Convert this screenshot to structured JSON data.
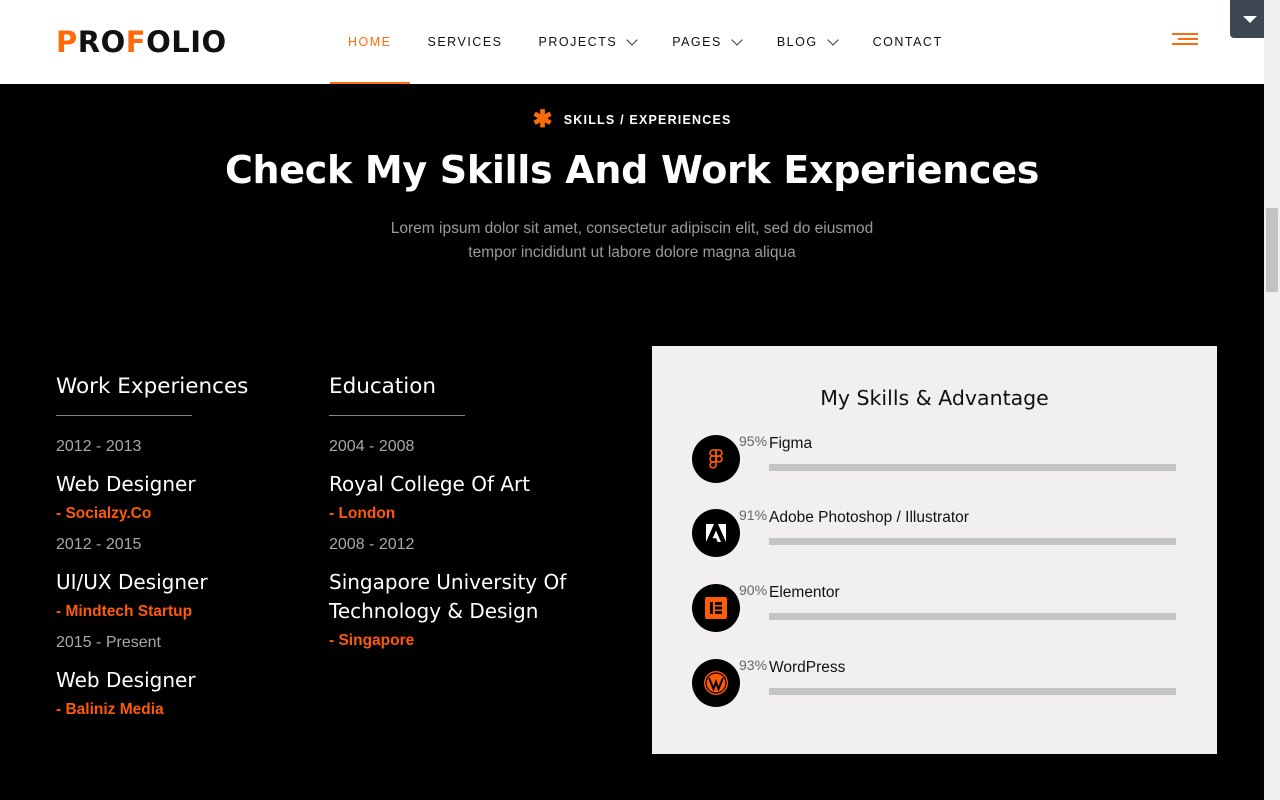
{
  "brand": {
    "logo": "PROFOLIO",
    "accent": "#ff6b0a"
  },
  "nav": [
    {
      "label": "HOME",
      "active": true,
      "dropdown": false
    },
    {
      "label": "SERVICES",
      "active": false,
      "dropdown": false
    },
    {
      "label": "PROJECTS",
      "active": false,
      "dropdown": true
    },
    {
      "label": "PAGES",
      "active": false,
      "dropdown": true
    },
    {
      "label": "BLOG",
      "active": false,
      "dropdown": true
    },
    {
      "label": "CONTACT",
      "active": false,
      "dropdown": false
    }
  ],
  "section": {
    "eyebrow": "SKILLS / EXPERIENCES",
    "title": "Check My Skills And Work Experiences",
    "subtitle_line1": "Lorem ipsum dolor sit amet, consectetur adipiscin elit, sed do eiusmod",
    "subtitle_line2": "tempor incididunt ut labore dolore magna aliqua"
  },
  "work": {
    "heading": "Work Experiences",
    "items": [
      {
        "years": "2012 - 2013",
        "role": "Web Designer",
        "place": "- Socialzy.Co"
      },
      {
        "years": "2012 - 2015",
        "role": "UI/UX Designer",
        "place": "- Mindtech Startup"
      },
      {
        "years": "2015 - Present",
        "role": "Web Designer",
        "place": "- Baliniz Media"
      }
    ]
  },
  "education": {
    "heading": "Education",
    "items": [
      {
        "years": "2004 - 2008",
        "role": "Royal College Of Art",
        "place": "- London"
      },
      {
        "years": "2008 - 2012",
        "role": "Singapore University Of Technology & Design",
        "place": "- Singapore"
      }
    ]
  },
  "skills": {
    "heading": "My Skills & Advantage",
    "items": [
      {
        "name": "Figma",
        "percent_label": "95%",
        "percent": 95,
        "icon": "figma-icon"
      },
      {
        "name": "Adobe Photoshop / Illustrator",
        "percent_label": "91%",
        "percent": 91,
        "icon": "adobe-icon"
      },
      {
        "name": "Elementor",
        "percent_label": "90%",
        "percent": 90,
        "icon": "elementor-icon"
      },
      {
        "name": "WordPress",
        "percent_label": "93%",
        "percent": 93,
        "icon": "wordpress-icon"
      }
    ]
  }
}
